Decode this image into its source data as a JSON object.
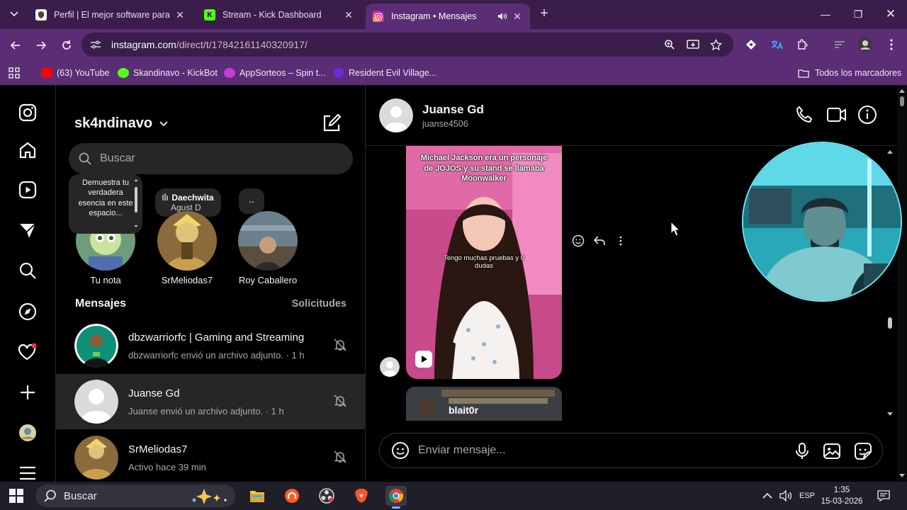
{
  "browser": {
    "tabs": [
      {
        "title": "Perfil | El mejor software para p",
        "favicon": "shield-icon",
        "active": false
      },
      {
        "title": "Stream - Kick Dashboard",
        "favicon": "kick-icon",
        "active": false
      },
      {
        "title": "Instagram • Mensajes",
        "favicon": "instagram-icon",
        "active": true
      }
    ],
    "url_domain": "instagram.com",
    "url_path": "/direct/t/17842161140320917/",
    "bookmarks": [
      {
        "label": "(63) YouTube",
        "color": "#ff0000"
      },
      {
        "label": "Skandinavo - KickBot",
        "color": "#53fc18"
      },
      {
        "label": "AppSorteos – Spin t...",
        "color": "#c23bd4"
      },
      {
        "label": "Resident Evil Village...",
        "color": "#6b2bd9"
      }
    ],
    "all_bookmarks": "Todos los marcadores"
  },
  "instagram": {
    "account": "sk4ndinavo",
    "search_placeholder": "Buscar",
    "own_note": "Demuestra tu verdadera esencia en este espacio...",
    "own_note_label": "Tu nota",
    "music_note": {
      "title": "Daechwita",
      "artist": "Agust D"
    },
    "dots_note": "..",
    "stories": [
      {
        "label": "SrMeliodas7"
      },
      {
        "label": "Roy Caballero"
      }
    ],
    "section_title": "Mensajes",
    "requests": "Solicitudes",
    "threads": [
      {
        "name": "dbzwarriorfc | Gaming and Streaming",
        "preview": "dbzwarriorfc envió un archivo adjunto. · 1 h",
        "selected": false
      },
      {
        "name": "Juanse Gd",
        "preview": "Juanse envió un archivo adjunto. · 1 h",
        "selected": true
      },
      {
        "name": "SrMeliodas7",
        "preview": "Activo hace 39 min",
        "selected": false
      }
    ],
    "chat": {
      "name": "Juanse Gd",
      "username": "juanse4506",
      "media_caption_top": "Michael Jackson era un personaje de JOJOS y su stand se llamaba Moonwalker",
      "media_caption_mid": "Tengo muchas pruebas y 0 dudas",
      "second_media_user": "blait0r",
      "composer_placeholder": "Enviar mensaje..."
    }
  },
  "taskbar": {
    "search": "Buscar",
    "lang": "ESP",
    "time": "1:35",
    "date": "15-03-2026"
  }
}
